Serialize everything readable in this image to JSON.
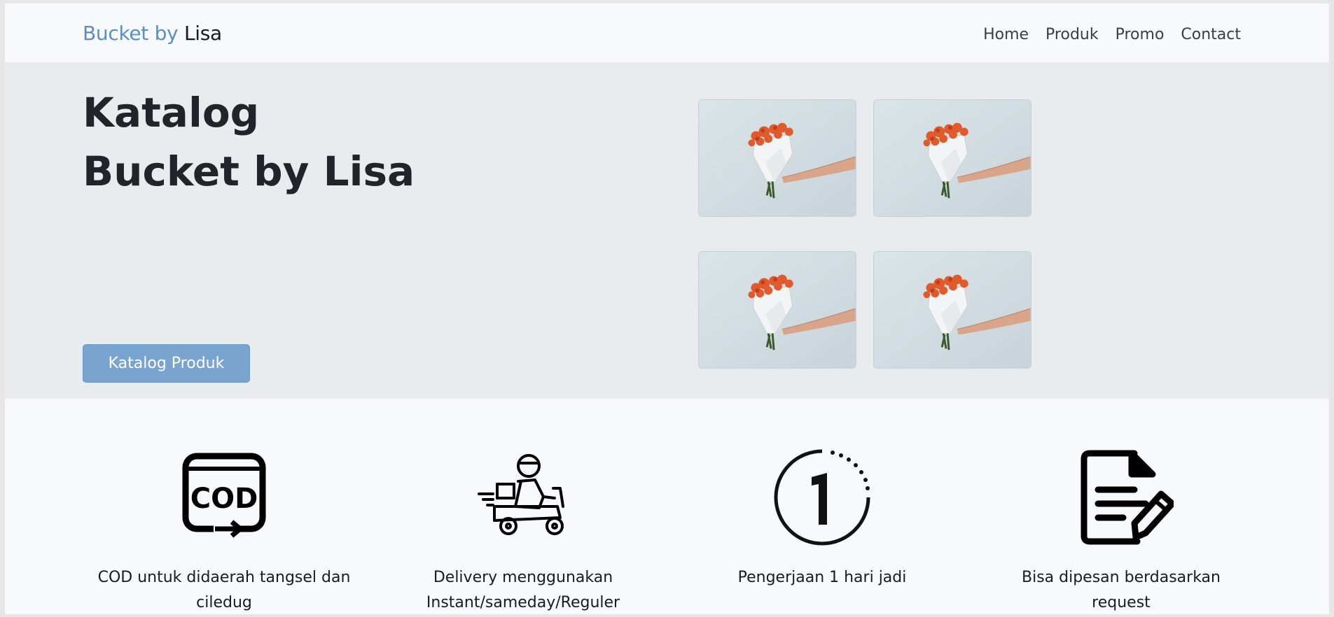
{
  "navbar": {
    "brand_part1": "Bucket by",
    "brand_part2": "Lisa",
    "links": [
      "Home",
      "Produk",
      "Promo",
      "Contact"
    ]
  },
  "hero": {
    "title_line1": "Katalog",
    "title_line2": "Bucket by Lisa",
    "button_label": "Katalog Produk",
    "images": [
      "flower-bouquet-image",
      "flower-bouquet-image",
      "flower-bouquet-image",
      "flower-bouquet-image"
    ]
  },
  "features": [
    {
      "icon": "cod-icon",
      "text": "COD untuk didaerah tangsel dan ciledug"
    },
    {
      "icon": "delivery-scooter-icon",
      "text": "Delivery menggunakan Instant/sameday/Reguler"
    },
    {
      "icon": "one-day-icon",
      "text": "Pengerjaan 1 hari jadi"
    },
    {
      "icon": "document-edit-icon",
      "text": "Bisa dipesan berdasarkan request"
    }
  ],
  "colors": {
    "brand_accent": "#5b8fc0",
    "button": "#79a4d0",
    "hero_bg": "#e8ecef",
    "page_bg": "#f7f9fd"
  }
}
